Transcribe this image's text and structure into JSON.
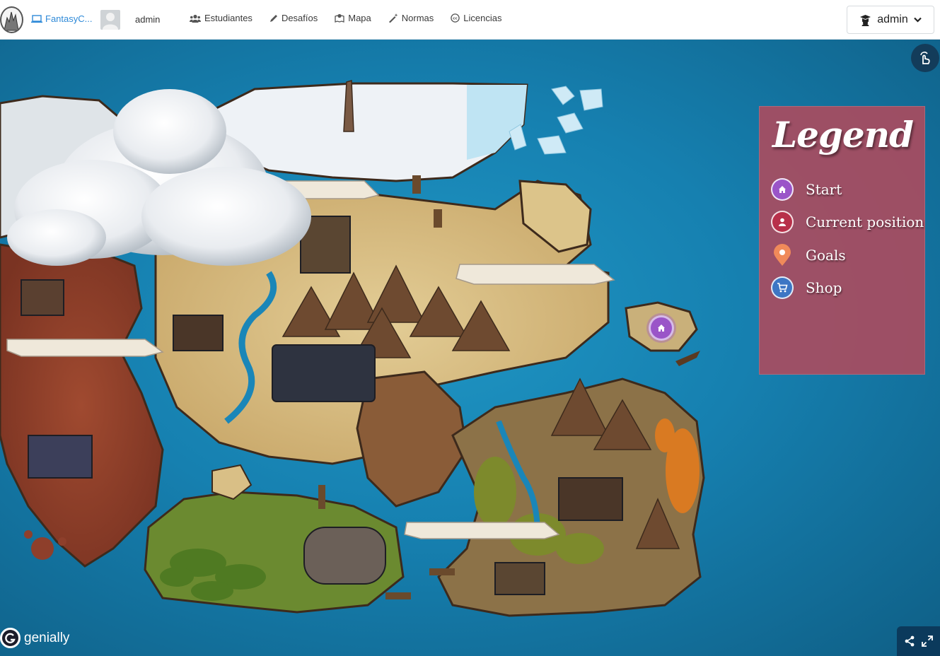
{
  "app": {
    "brand_label": "FantasyC...",
    "username": "admin"
  },
  "nav": {
    "items": [
      {
        "label": "Estudiantes",
        "icon": "users-icon"
      },
      {
        "label": "Desafíos",
        "icon": "pen-icon"
      },
      {
        "label": "Mapa",
        "icon": "map-icon"
      },
      {
        "label": "Normas",
        "icon": "magic-wand-icon"
      },
      {
        "label": "Licencias",
        "icon": "creative-commons-icon"
      }
    ]
  },
  "user_menu": {
    "label": "admin",
    "icon": "graduation-cap-icon"
  },
  "legend": {
    "title": "Legend",
    "items": [
      {
        "label": "Start",
        "icon": "home-icon",
        "color": "#9a55c8"
      },
      {
        "label": "Current position",
        "icon": "person-icon",
        "color": "#b8304a"
      },
      {
        "label": "Goals",
        "icon": "location-pin-icon",
        "color": "#f08a5a"
      },
      {
        "label": "Shop",
        "icon": "cart-icon",
        "color": "#3d76c4"
      }
    ]
  },
  "footer": {
    "brand": "genially"
  },
  "colors": {
    "sea": "#1680b0",
    "legend_bg": "#b04a5c",
    "brand_link": "#2f8ad8",
    "desert": "#d9bf86",
    "red_land": "#8e3f2b",
    "forest": "#6b8a30",
    "snow": "#eef2f6"
  }
}
